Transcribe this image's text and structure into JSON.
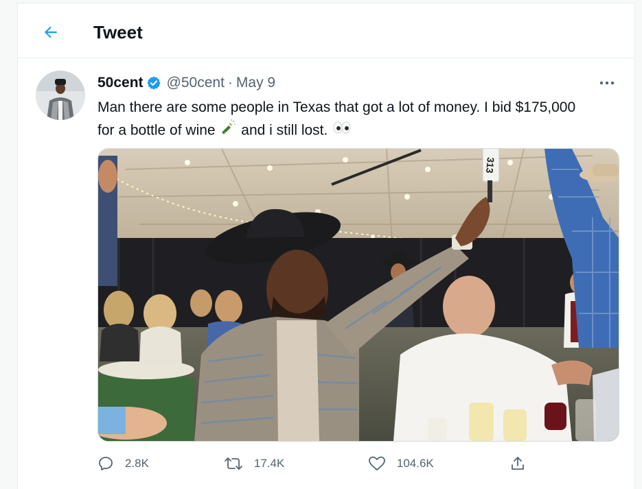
{
  "header": {
    "title": "Tweet"
  },
  "tweet": {
    "display_name": "50cent",
    "handle": "@50cent",
    "separator": "·",
    "date": "May 9",
    "text_line1": "Man there are some people in Texas that got a lot of money. I bid $175,000",
    "text_line2_a": "for a bottle of wine",
    "text_line2_b": "and i still lost.",
    "emoji_1": "bottle-with-popping-cork",
    "emoji_2": "eyes",
    "media_placeholder_number": "313"
  },
  "actions": {
    "replies": "2.8K",
    "retweets": "17.4K",
    "likes": "104.6K"
  },
  "colors": {
    "accent": "#1d9bf0",
    "muted": "#536471",
    "border": "#e6ecf0"
  },
  "icons": [
    "back-arrow-icon",
    "verified-badge-icon",
    "more-icon",
    "reply-icon",
    "retweet-icon",
    "like-icon",
    "share-icon"
  ]
}
